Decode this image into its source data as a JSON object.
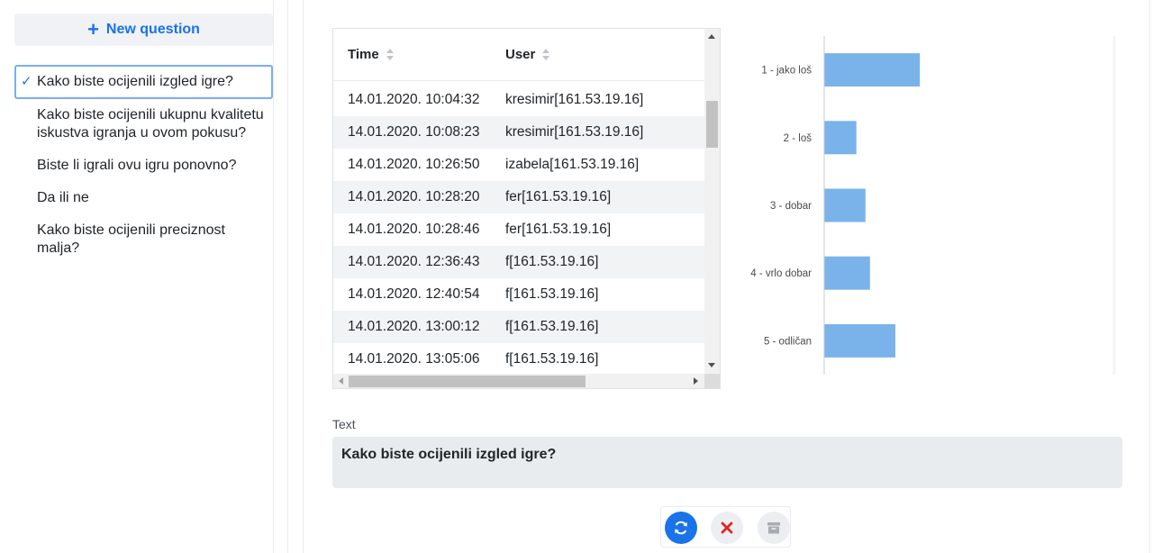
{
  "sidebar": {
    "new_question_label": "New question",
    "questions": [
      {
        "text": "Kako biste ocijenili izgled igre?",
        "active": true
      },
      {
        "text": "Kako biste ocijenili ukupnu kvalitetu iskustva igranja u ovom pokusu?",
        "active": false
      },
      {
        "text": "Biste li igrali ovu igru ponovno?",
        "active": false
      },
      {
        "text": "Da ili ne",
        "active": false
      },
      {
        "text": "Kako biste ocijenili preciznost malja?",
        "active": false
      }
    ]
  },
  "table": {
    "columns": [
      "Time",
      "User"
    ],
    "rows": [
      [
        "14.01.2020. 10:04:32",
        "kresimir[161.53.19.16]"
      ],
      [
        "14.01.2020. 10:08:23",
        "kresimir[161.53.19.16]"
      ],
      [
        "14.01.2020. 10:26:50",
        "izabela[161.53.19.16]"
      ],
      [
        "14.01.2020. 10:28:20",
        "fer[161.53.19.16]"
      ],
      [
        "14.01.2020. 10:28:46",
        "fer[161.53.19.16]"
      ],
      [
        "14.01.2020. 12:36:43",
        "f[161.53.19.16]"
      ],
      [
        "14.01.2020. 12:40:54",
        "f[161.53.19.16]"
      ],
      [
        "14.01.2020. 13:00:12",
        "f[161.53.19.16]"
      ],
      [
        "14.01.2020. 13:05:06",
        "f[161.53.19.16]"
      ]
    ]
  },
  "chart_data": {
    "type": "bar",
    "orientation": "horizontal",
    "categories": [
      "1 - jako loš",
      "2 - loš",
      "3 - dobar",
      "4 - vrlo dobar",
      "5 - odličan"
    ],
    "values": [
      10.5,
      3.5,
      4.5,
      5,
      7.8
    ],
    "xlim": [
      0,
      32
    ],
    "color": "#7ab3ea",
    "grid": false
  },
  "text_field": {
    "label": "Text",
    "value": "Kako biste ocijenili izgled igre?"
  },
  "actions": {
    "refresh_icon": "refresh-icon",
    "cancel_icon": "close-icon",
    "archive_icon": "archive-icon"
  }
}
